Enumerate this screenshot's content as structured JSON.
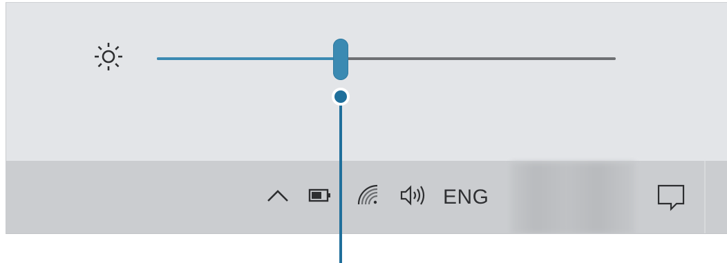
{
  "brightness": {
    "icon": "sun-icon",
    "level_fraction": 0.4
  },
  "taskbar": {
    "tray_icons": [
      "chevron-up-icon",
      "battery-icon",
      "wifi-icon",
      "speaker-icon",
      "action-center-icon"
    ],
    "language": "ENG"
  },
  "colors": {
    "slider_accent": "#3b8ab2",
    "callout": "#1f6f9b",
    "panel_bg": "#e3e5e8",
    "taskbar_bg": "#cbcdd0"
  }
}
